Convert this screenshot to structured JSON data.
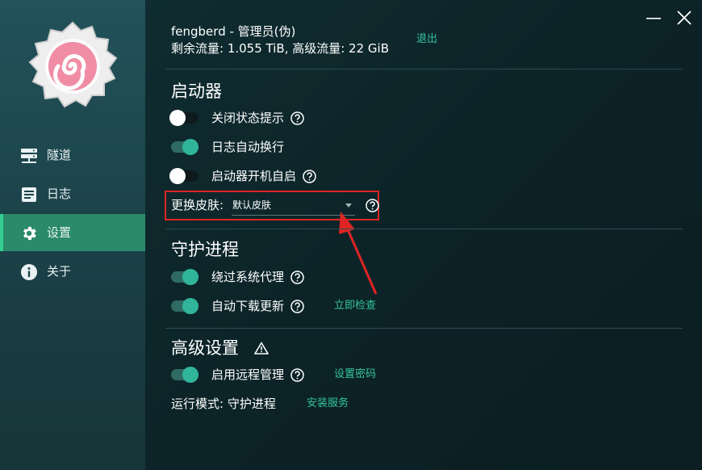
{
  "sidebar": {
    "items": [
      {
        "label": "隧道",
        "icon": "server-icon"
      },
      {
        "label": "日志",
        "icon": "document-icon"
      },
      {
        "label": "设置",
        "icon": "gear-icon",
        "active": true
      },
      {
        "label": "关于",
        "icon": "info-icon"
      }
    ]
  },
  "header": {
    "user": "fengberd - 管理员(伪)",
    "traffic": "剩余流量: 1.055 TiB, 高级流量: 22 GiB",
    "logout": "退出"
  },
  "launcher": {
    "title": "启动器",
    "close_status_tip": {
      "label": "关闭状态提示",
      "on": false
    },
    "log_wrap": {
      "label": "日志自动换行",
      "on": true
    },
    "autostart": {
      "label": "启动器开机自启",
      "on": false
    },
    "skin": {
      "label": "更换皮肤:",
      "value": "默认皮肤"
    }
  },
  "daemon": {
    "title": "守护进程",
    "bypass_proxy": {
      "label": "绕过系统代理",
      "on": true
    },
    "auto_update": {
      "label": "自动下载更新",
      "on": true,
      "link": "立即检查"
    }
  },
  "advanced": {
    "title": "高级设置",
    "remote": {
      "label": "启用远程管理",
      "on": true,
      "link": "设置密码"
    },
    "mode": {
      "label": "运行模式: 守护进程",
      "link": "安装服务"
    }
  },
  "colors": {
    "accent": "#35c3a0",
    "active_nav": "#2a8a6a",
    "highlight_box": "#e02424"
  }
}
